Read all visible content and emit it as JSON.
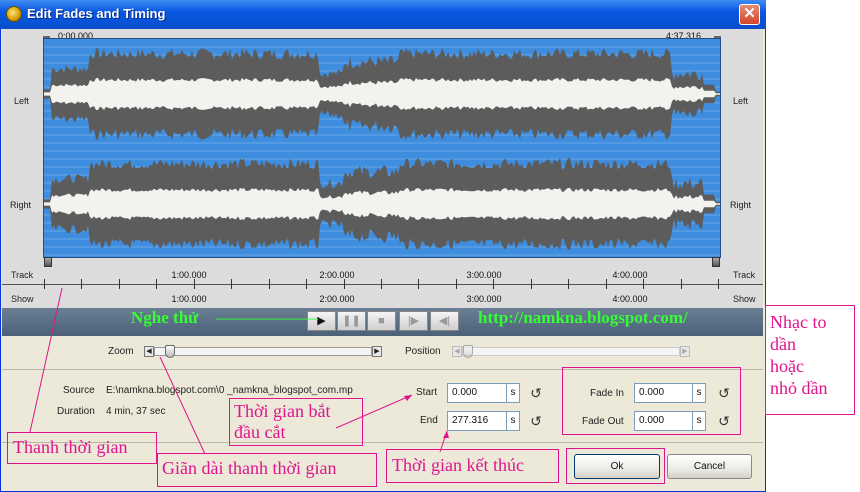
{
  "window": {
    "title": "Edit Fades and Timing",
    "close_glyph": "✕"
  },
  "waveform": {
    "start_time": "0:00.000",
    "end_time": "4:37.316",
    "channel_left": "Left",
    "channel_right": "Right",
    "track_label": "Track",
    "show_label": "Show",
    "ticks": [
      "1:00.000",
      "2:00.000",
      "3:00.000",
      "4:00.000"
    ]
  },
  "transport": {
    "play_icon": "play-icon",
    "pause_icon": "pause-icon",
    "stop_icon": "stop-icon",
    "next_icon": "skip-forward-icon",
    "prev_icon": "skip-back-icon"
  },
  "zoom": {
    "label": "Zoom",
    "level": 0.05
  },
  "position": {
    "label": "Position",
    "level": 0.0
  },
  "info": {
    "source_label": "Source",
    "source_value": "E:\\namkna.blogspot.com\\0 _namkna_blogspot_com.mp",
    "duration_label": "Duration",
    "duration_value": "4 min, 37 sec"
  },
  "timing": {
    "start_label": "Start",
    "start_value": "0.000",
    "end_label": "End",
    "end_value": "277.316",
    "unit": "s"
  },
  "fades": {
    "fade_in_label": "Fade In",
    "fade_in_value": "0.000",
    "fade_out_label": "Fade Out",
    "fade_out_value": "0.000",
    "unit": "s"
  },
  "buttons": {
    "ok": "Ok",
    "cancel": "Cancel"
  },
  "annotations": {
    "preview": "Nghe thử",
    "dashes": "——————",
    "url": "http://namkna.blogspot.com/",
    "fade_note": "Nhạc to\ndần\nhoặc\nnhỏ dần",
    "timeline": "Thanh thời gian",
    "start_cut": "Thời gian bắt\nđầu cắt",
    "stretch": "Giãn dài thanh thời gian",
    "end_time": "Thời gian kết thúc"
  },
  "colors": {
    "annotation_pink": "#e0148c",
    "annotation_green": "#33ff33",
    "wave_background": "#3e8dde",
    "wave_fill": "#5c5c5c",
    "wave_core": "#f2f2ee"
  }
}
